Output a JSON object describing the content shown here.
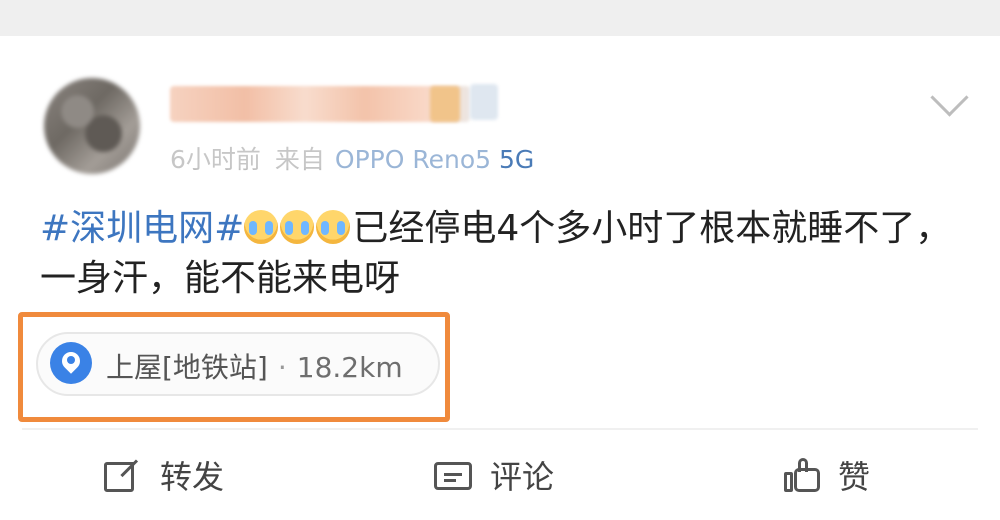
{
  "post": {
    "username": "●●●●●●●●",
    "time": "6小时前",
    "source_prefix": "来自",
    "device": "OPPO Reno5 5G",
    "topic": "#深圳电网#",
    "emojis": [
      "crying-face-icon",
      "crying-face-icon",
      "crying-face-icon"
    ],
    "text": "已经停电4个多小时了根本就睡不了，一身汗，能不能来电呀"
  },
  "location": {
    "name": "上屋[地铁站]",
    "separator": "·",
    "distance": "18.2km"
  },
  "actions": {
    "share_label": "转发",
    "comment_label": "评论",
    "like_label": "赞"
  },
  "colors": {
    "topic": "#3d76c0",
    "device": "#4a7bb7",
    "highlight": "#f08a3c",
    "location_icon": "#3a82e6",
    "background_band": "#efefef"
  }
}
